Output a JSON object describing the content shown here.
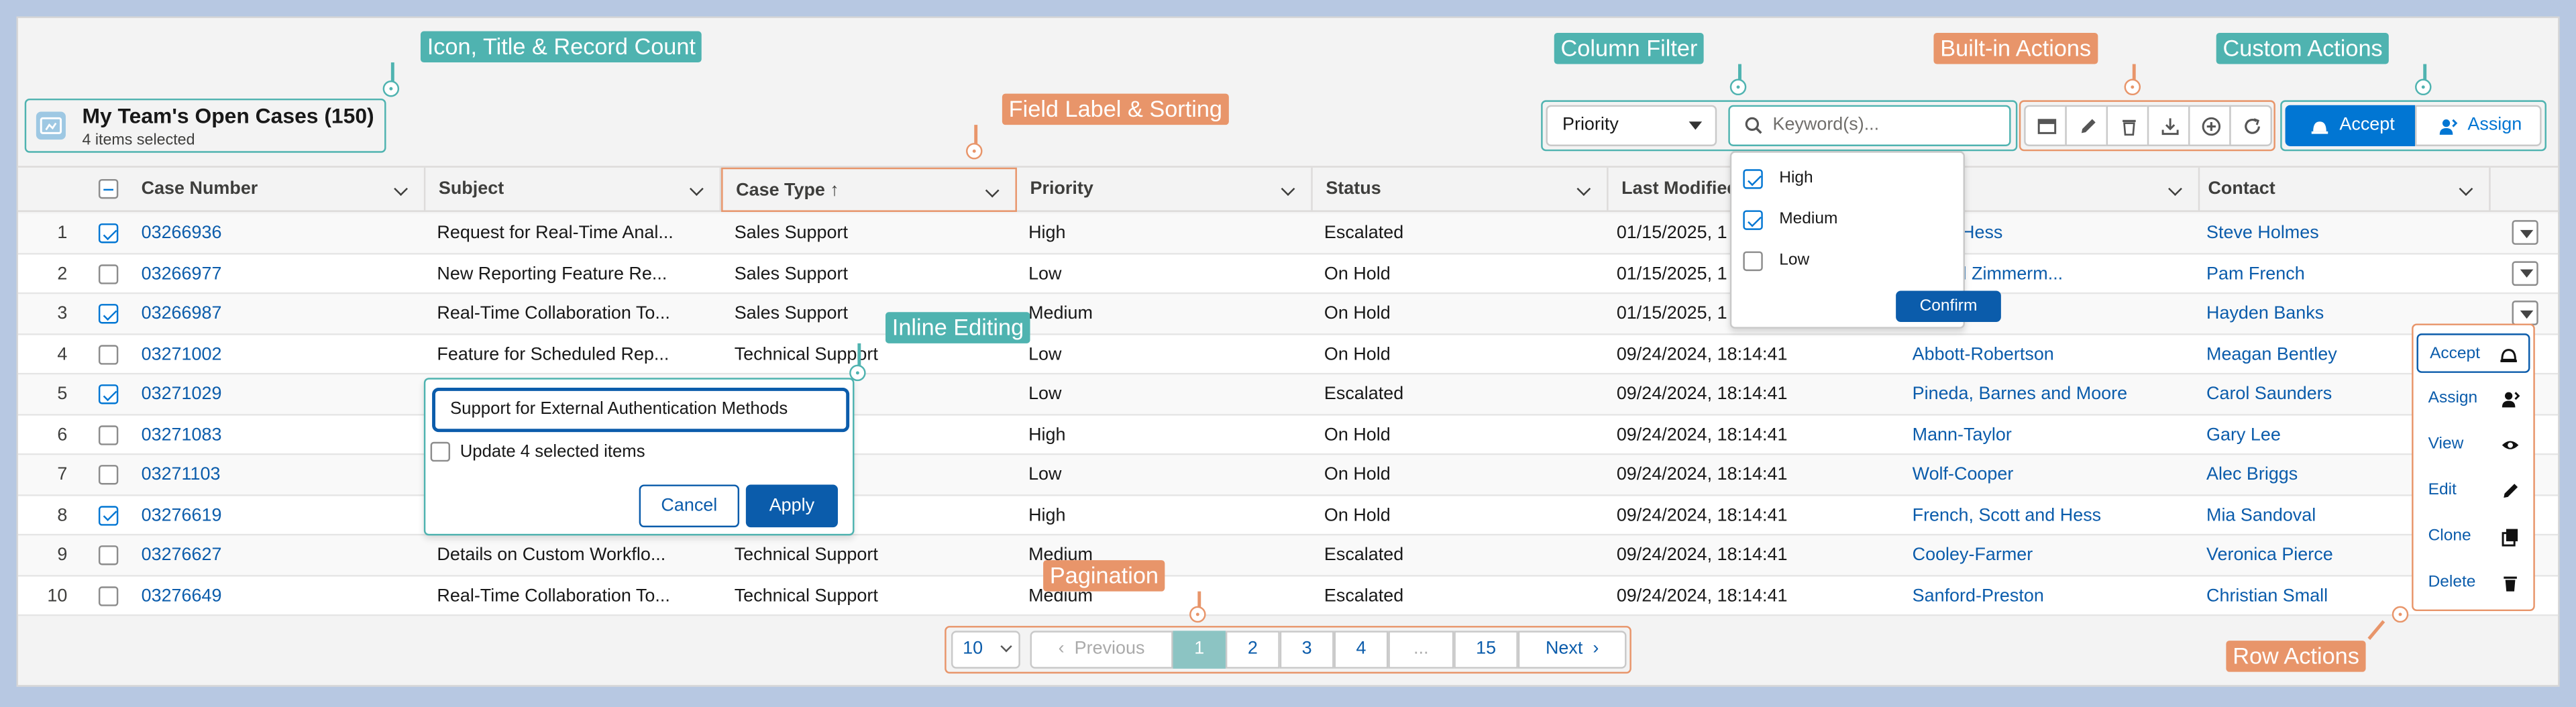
{
  "header": {
    "title": "My Team's Open Cases (150)",
    "subtitle": "4 items selected"
  },
  "annotations": {
    "icon_title": "Icon, Title & Record Count",
    "field_label": "Field Label & Sorting",
    "column_filter": "Column Filter",
    "builtin": "Built-in Actions",
    "custom": "Custom Actions",
    "inline": "Inline Editing",
    "pagination": "Pagination",
    "row_actions": "Row Actions"
  },
  "toolbar": {
    "filter_select": "Priority",
    "search_placeholder": "Keyword(s)...",
    "builtin_icons": [
      "card-view-icon",
      "edit-pencil-icon",
      "delete-trash-icon",
      "download-icon",
      "add-circle-icon",
      "refresh-icon"
    ],
    "accept_label": "Accept",
    "assign_label": "Assign"
  },
  "columns": [
    "Case Number",
    "Subject",
    "Case Type",
    "Priority",
    "Status",
    "Last Modified",
    "",
    "Contact"
  ],
  "sorted_column": "Case Type",
  "rows": [
    {
      "n": "1",
      "checked": true,
      "case": "03266936",
      "subject": "Request for Real-Time Anal...",
      "type": "Sales Support",
      "priority": "High",
      "status": "Escalated",
      "modified": "01/15/2025, 1",
      "account": "s and Hess",
      "contact": "Steve Holmes"
    },
    {
      "n": "2",
      "checked": false,
      "case": "03266977",
      "subject": "New Reporting Feature Re...",
      "type": "Sales Support",
      "priority": "Low",
      "status": "On Hold",
      "modified": "01/15/2025, 1",
      "account": "ch and Zimmerm...",
      "contact": "Pam French"
    },
    {
      "n": "3",
      "checked": true,
      "case": "03266987",
      "subject": "Real-Time Collaboration To...",
      "type": "Sales Support",
      "priority": "Medium",
      "status": "On Hold",
      "modified": "01/15/2025, 1",
      "account": "re",
      "contact": "Hayden Banks"
    },
    {
      "n": "4",
      "checked": false,
      "case": "03271002",
      "subject": "Feature for Scheduled Rep...",
      "type": "Technical Support",
      "priority": "Low",
      "status": "On Hold",
      "modified": "09/24/2024, 18:14:41",
      "account": "Abbott-Robertson",
      "contact": "Meagan Bentley"
    },
    {
      "n": "5",
      "checked": true,
      "case": "03271029",
      "subject": "",
      "type": "port",
      "priority": "Low",
      "status": "Escalated",
      "modified": "09/24/2024, 18:14:41",
      "account": "Pineda, Barnes and Moore",
      "contact": "Carol Saunders"
    },
    {
      "n": "6",
      "checked": false,
      "case": "03271083",
      "subject": "",
      "type": "port",
      "priority": "High",
      "status": "On Hold",
      "modified": "09/24/2024, 18:14:41",
      "account": "Mann-Taylor",
      "contact": "Gary Lee"
    },
    {
      "n": "7",
      "checked": false,
      "case": "03271103",
      "subject": "",
      "type": "port",
      "priority": "Low",
      "status": "On Hold",
      "modified": "09/24/2024, 18:14:41",
      "account": "Wolf-Cooper",
      "contact": "Alec Briggs"
    },
    {
      "n": "8",
      "checked": true,
      "case": "03276619",
      "subject": "",
      "type": "port",
      "priority": "High",
      "status": "On Hold",
      "modified": "09/24/2024, 18:14:41",
      "account": "French, Scott and Hess",
      "contact": "Mia Sandoval"
    },
    {
      "n": "9",
      "checked": false,
      "case": "03276627",
      "subject": "Details on Custom Workflo...",
      "type": "Technical Support",
      "priority": "Medium",
      "status": "Escalated",
      "modified": "09/24/2024, 18:14:41",
      "account": "Cooley-Farmer",
      "contact": "Veronica Pierce"
    },
    {
      "n": "10",
      "checked": false,
      "case": "03276649",
      "subject": "Real-Time Collaboration To...",
      "type": "Technical Support",
      "priority": "Medium",
      "status": "Escalated",
      "modified": "09/24/2024, 18:14:41",
      "account": "Sanford-Preston",
      "contact": "Christian Small"
    }
  ],
  "filter_popover": {
    "options": [
      {
        "label": "High",
        "checked": true
      },
      {
        "label": "Medium",
        "checked": true
      },
      {
        "label": "Low",
        "checked": false
      }
    ],
    "confirm": "Confirm"
  },
  "inline_edit": {
    "value": "Support for External Authentication Methods",
    "update_label": "Update 4 selected items",
    "cancel": "Cancel",
    "apply": "Apply"
  },
  "row_actions": [
    {
      "label": "Accept",
      "icon": "accept-icon"
    },
    {
      "label": "Assign",
      "icon": "assign-icon"
    },
    {
      "label": "View",
      "icon": "eye-icon"
    },
    {
      "label": "Edit",
      "icon": "pencil-icon"
    },
    {
      "label": "Clone",
      "icon": "clone-icon"
    },
    {
      "label": "Delete",
      "icon": "trash-icon"
    }
  ],
  "pagination": {
    "page_size": "10",
    "previous": "Previous",
    "pages": [
      "1",
      "2",
      "3",
      "4",
      "...",
      "15"
    ],
    "current": "1",
    "next": "Next"
  },
  "colors": {
    "teal": "#4fb3b0",
    "orange": "#e8956a",
    "brand": "#0176d3",
    "link": "#0b5cab"
  }
}
